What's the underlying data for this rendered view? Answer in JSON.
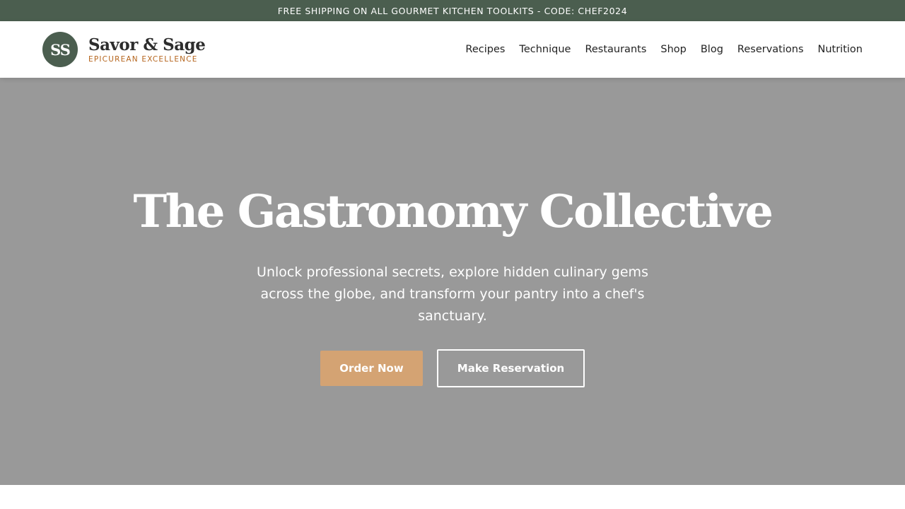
{
  "promo": {
    "text": "FREE SHIPPING ON ALL GOURMET KITCHEN TOOLKITS - CODE: CHEF2024"
  },
  "brand": {
    "monogram": "SS",
    "name": "Savor & Sage",
    "tagline": "EPICUREAN EXCELLENCE"
  },
  "nav": {
    "items": [
      {
        "label": "Recipes"
      },
      {
        "label": "Technique"
      },
      {
        "label": "Restaurants"
      },
      {
        "label": "Shop"
      },
      {
        "label": "Blog"
      },
      {
        "label": "Reservations"
      },
      {
        "label": "Nutrition"
      }
    ]
  },
  "hero": {
    "title": "The Gastronomy Collective",
    "subtitle": "Unlock professional secrets, explore hidden culinary gems across the globe, and transform your pantry into a chef's sanctuary.",
    "primary_button": "Order Now",
    "secondary_button": "Make Reservation"
  },
  "colors": {
    "promo_bg": "#4b5e4f",
    "brand_green": "#4b5e4f",
    "accent_gold": "#d4a373",
    "tagline": "#b5651d",
    "hero_bg": "#999999"
  }
}
